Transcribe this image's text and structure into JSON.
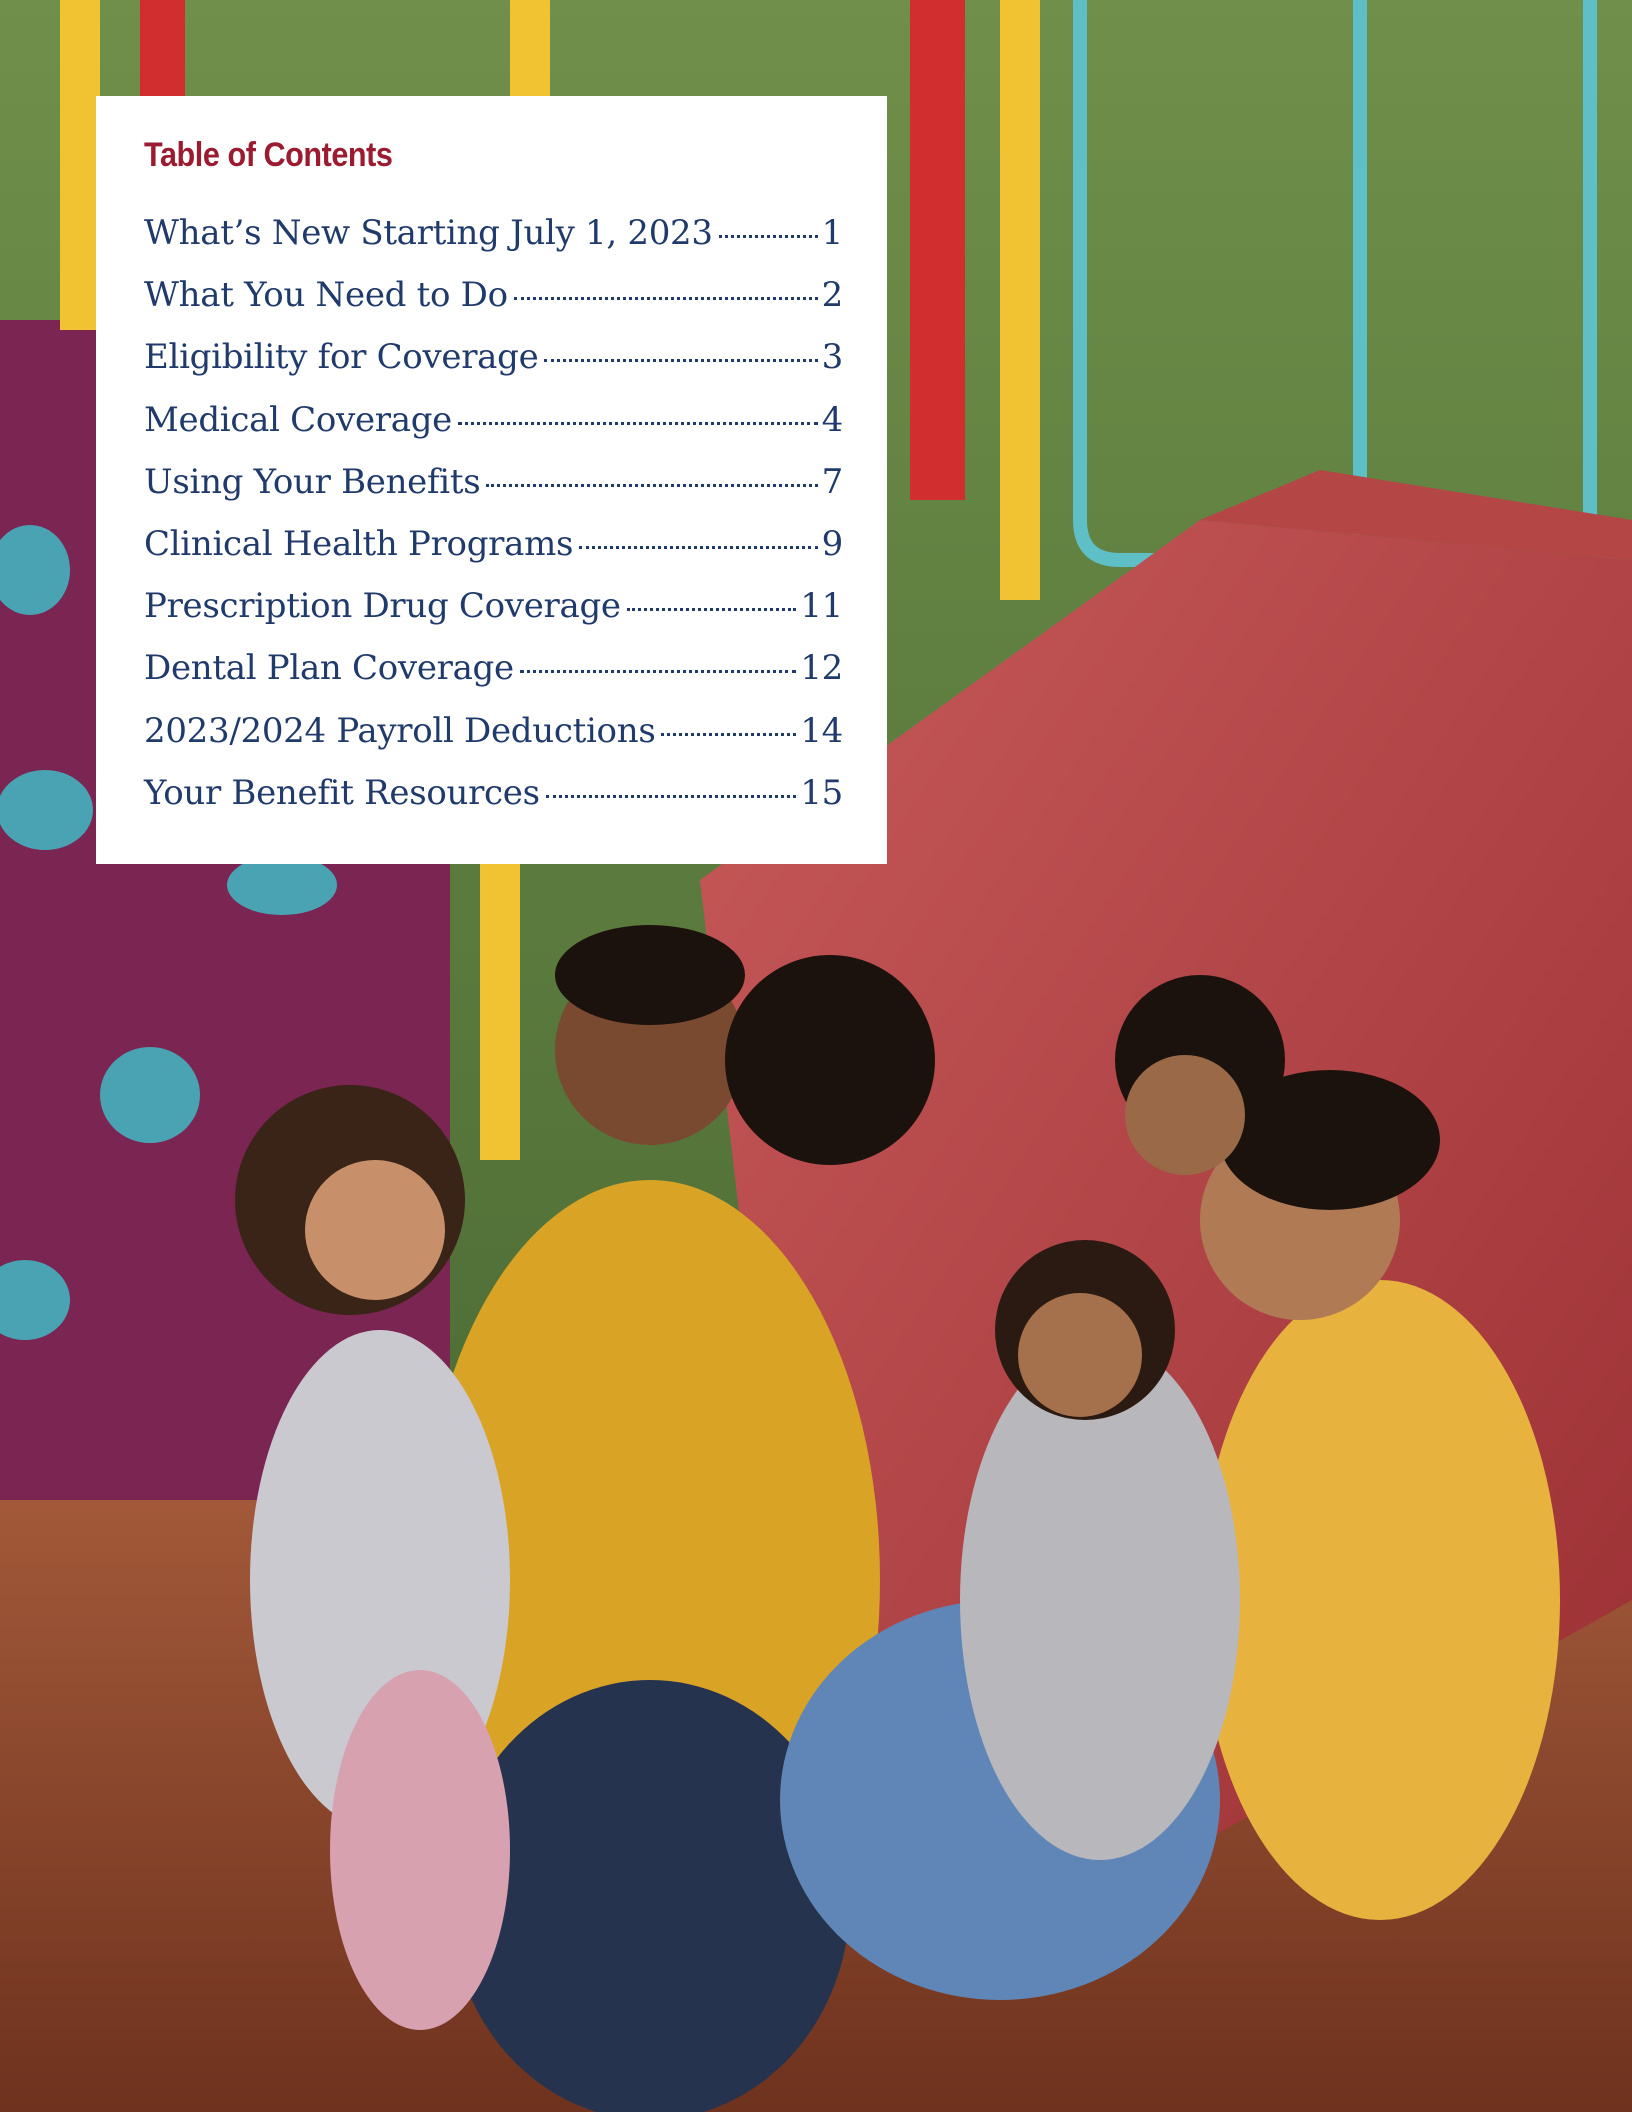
{
  "toc": {
    "title": "Table of Contents",
    "entries": [
      {
        "label": "What’s New Starting July 1, 2023",
        "page": "1"
      },
      {
        "label": "What You Need to Do",
        "page": "2"
      },
      {
        "label": "Eligibility for Coverage",
        "page": "3"
      },
      {
        "label": "Medical Coverage",
        "page": "4"
      },
      {
        "label": "Using Your Benefits",
        "page": "7"
      },
      {
        "label": "Clinical Health Programs",
        "page": "9"
      },
      {
        "label": "Prescription Drug Coverage",
        "page": "11"
      },
      {
        "label": "Dental Plan Coverage",
        "page": "12"
      },
      {
        "label": "2023/2024 Payroll Deductions",
        "page": "14"
      },
      {
        "label": "Your Benefit Resources",
        "page": "15"
      }
    ]
  },
  "colors": {
    "title": "#9b1b30",
    "entry_text": "#1f3a6b",
    "panel_background": "#ffffff"
  }
}
